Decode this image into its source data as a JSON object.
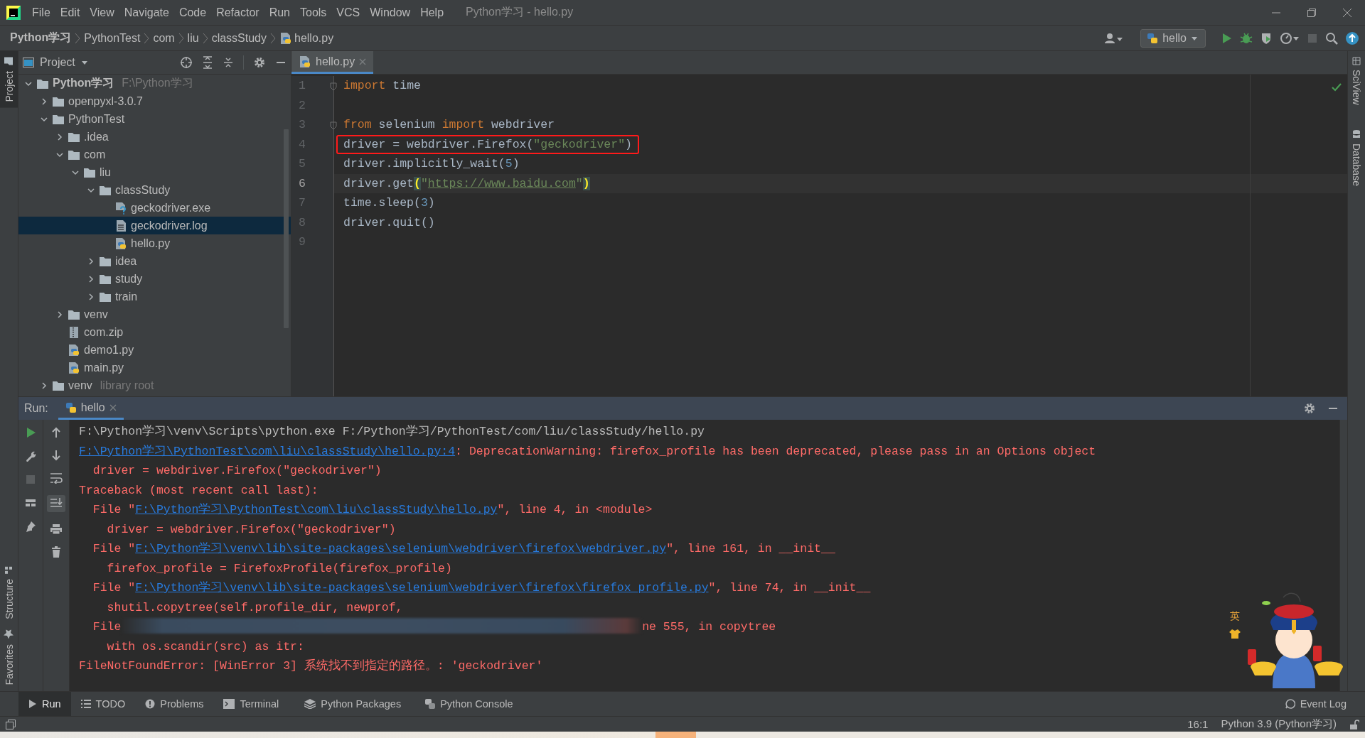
{
  "window": {
    "title": "Python学习 - hello.py",
    "menu": [
      "File",
      "Edit",
      "View",
      "Navigate",
      "Code",
      "Refactor",
      "Run",
      "Tools",
      "VCS",
      "Window",
      "Help"
    ]
  },
  "breadcrumbs": [
    {
      "label": "Python学习",
      "kind": "root"
    },
    {
      "label": "PythonTest",
      "kind": "folder"
    },
    {
      "label": "com",
      "kind": "folder"
    },
    {
      "label": "liu",
      "kind": "folder"
    },
    {
      "label": "classStudy",
      "kind": "folder"
    },
    {
      "label": "hello.py",
      "kind": "python"
    }
  ],
  "run_configuration": "hello",
  "side_stripes": {
    "left_top": [
      {
        "label": "Project",
        "selected": true
      }
    ],
    "left_bottom": [
      {
        "label": "Structure",
        "selected": false
      },
      {
        "label": "Favorites",
        "selected": false
      }
    ],
    "right": [
      {
        "label": "SciView",
        "selected": false
      },
      {
        "label": "Database",
        "selected": false
      }
    ]
  },
  "project_panel": {
    "title": "Project",
    "tree": [
      {
        "label": "Python学习",
        "kind": "project_root",
        "note": "F:\\Python学习",
        "expanded": true,
        "selected": false,
        "children": [
          {
            "label": "openpyxl-3.0.7",
            "kind": "folder",
            "expanded": false,
            "selected": false
          },
          {
            "label": "PythonTest",
            "kind": "folder",
            "expanded": true,
            "selected": false,
            "children": [
              {
                "label": ".idea",
                "kind": "folder",
                "expanded": false,
                "selected": false
              },
              {
                "label": "com",
                "kind": "folder",
                "expanded": true,
                "selected": false,
                "children": [
                  {
                    "label": "liu",
                    "kind": "folder",
                    "expanded": true,
                    "selected": false,
                    "children": [
                      {
                        "label": "classStudy",
                        "kind": "folder",
                        "expanded": true,
                        "selected": false,
                        "children": [
                          {
                            "label": "geckodriver.exe",
                            "kind": "unknown",
                            "selected": false
                          },
                          {
                            "label": "geckodriver.log",
                            "kind": "log",
                            "selected": true
                          },
                          {
                            "label": "hello.py",
                            "kind": "python",
                            "selected": false
                          }
                        ]
                      },
                      {
                        "label": "idea",
                        "kind": "folder",
                        "expanded": false,
                        "selected": false
                      },
                      {
                        "label": "study",
                        "kind": "folder",
                        "expanded": false,
                        "selected": false
                      },
                      {
                        "label": "train",
                        "kind": "folder",
                        "expanded": false,
                        "selected": false
                      }
                    ]
                  }
                ]
              },
              {
                "label": "venv",
                "kind": "folder",
                "expanded": false,
                "selected": false
              },
              {
                "label": "com.zip",
                "kind": "zip",
                "selected": false
              },
              {
                "label": "demo1.py",
                "kind": "python",
                "selected": false
              },
              {
                "label": "main.py",
                "kind": "python",
                "selected": false
              }
            ]
          },
          {
            "label": "venv",
            "kind": "folder",
            "note": "library root",
            "expanded": false,
            "selected": false
          }
        ]
      }
    ]
  },
  "editor": {
    "tab": {
      "label": "hello.py",
      "selected": true
    },
    "lines": [
      {
        "number": "1",
        "current": false,
        "boxed": false,
        "fold": true,
        "tokens": [
          {
            "text": "import",
            "kind": "keyword"
          },
          {
            "text": " time",
            "kind": "plain"
          }
        ]
      },
      {
        "number": "2"
      },
      {
        "number": "3",
        "current": false,
        "boxed": false,
        "fold": true,
        "tokens": [
          {
            "text": "from",
            "kind": "keyword"
          },
          {
            "text": " selenium ",
            "kind": "plain"
          },
          {
            "text": "import",
            "kind": "keyword"
          },
          {
            "text": " webdriver",
            "kind": "plain"
          }
        ]
      },
      {
        "number": "4",
        "current": false,
        "boxed": true,
        "fold": false,
        "tokens": [
          {
            "text": "driver = webdriver.Firefox(",
            "kind": "plain"
          },
          {
            "text": "\"geckodriver\"",
            "kind": "string"
          },
          {
            "text": ")",
            "kind": "plain"
          }
        ]
      },
      {
        "number": "5",
        "current": false,
        "boxed": false,
        "fold": false,
        "tokens": [
          {
            "text": "driver.implicitly_wait(",
            "kind": "plain"
          },
          {
            "text": "5",
            "kind": "number"
          },
          {
            "text": ")",
            "kind": "plain"
          }
        ]
      },
      {
        "number": "6",
        "current": true,
        "boxed": false,
        "fold": false,
        "tokens": [
          {
            "text": "driver.get",
            "kind": "plain"
          },
          {
            "text": "(",
            "kind": "brace"
          },
          {
            "text": "\"",
            "kind": "string"
          },
          {
            "text": "https://www.baidu.com",
            "kind": "url"
          },
          {
            "text": "\"",
            "kind": "string"
          },
          {
            "text": ")",
            "kind": "brace"
          }
        ]
      },
      {
        "number": "7",
        "current": false,
        "boxed": false,
        "fold": false,
        "tokens": [
          {
            "text": "time.sleep(",
            "kind": "plain"
          },
          {
            "text": "3",
            "kind": "number"
          },
          {
            "text": ")",
            "kind": "plain"
          }
        ]
      },
      {
        "number": "8",
        "current": false,
        "boxed": false,
        "fold": false,
        "tokens": [
          {
            "text": "driver.quit()",
            "kind": "plain"
          }
        ]
      },
      {
        "number": "9"
      }
    ]
  },
  "run_panel": {
    "label": "Run:",
    "tab": {
      "label": "hello",
      "selected": true
    },
    "output": [
      {
        "segments": [
          {
            "text": "F:\\Python学习\\venv\\Scripts\\python.exe F:/Python学习/PythonTest/com/liu/classStudy/hello.py",
            "kind": "plain"
          }
        ]
      },
      {
        "segments": [
          {
            "text": "F:\\Python学习\\PythonTest\\com\\liu\\classStudy\\hello.py:4",
            "kind": "link"
          },
          {
            "text": ": DeprecationWarning: firefox_profile has been deprecated, please pass in an Options object",
            "kind": "error"
          }
        ]
      },
      {
        "segments": [
          {
            "text": "  driver = webdriver.Firefox(\"geckodriver\")",
            "kind": "error"
          }
        ]
      },
      {
        "segments": [
          {
            "text": "Traceback (most recent call last):",
            "kind": "error"
          }
        ]
      },
      {
        "segments": [
          {
            "text": "  File \"",
            "kind": "error"
          },
          {
            "text": "F:\\Python学习\\PythonTest\\com\\liu\\classStudy\\hello.py",
            "kind": "link"
          },
          {
            "text": "\", line 4, in <module>",
            "kind": "error"
          }
        ]
      },
      {
        "segments": [
          {
            "text": "    driver = webdriver.Firefox(\"geckodriver\")",
            "kind": "error"
          }
        ]
      },
      {
        "segments": [
          {
            "text": "  File \"",
            "kind": "error"
          },
          {
            "text": "F:\\Python学习\\venv\\lib\\site-packages\\selenium\\webdriver\\firefox\\webdriver.py",
            "kind": "link"
          },
          {
            "text": "\", line 161, in __init__",
            "kind": "error"
          }
        ]
      },
      {
        "segments": [
          {
            "text": "    firefox_profile = FirefoxProfile(firefox_profile)",
            "kind": "error"
          }
        ]
      },
      {
        "segments": [
          {
            "text": "  File \"",
            "kind": "error"
          },
          {
            "text": "F:\\Python学习\\venv\\lib\\site-packages\\selenium\\webdriver\\firefox\\firefox_profile.py",
            "kind": "link"
          },
          {
            "text": "\", line 74, in __init__",
            "kind": "error"
          }
        ]
      },
      {
        "segments": [
          {
            "text": "    shutil.copytree(self.profile_dir, newprof,",
            "kind": "error"
          }
        ]
      },
      {
        "segments": [
          {
            "text": "  File",
            "kind": "error"
          },
          {
            "kind": "redacted"
          },
          {
            "text": "ne 555, in copytree",
            "kind": "error"
          }
        ]
      },
      {
        "segments": [
          {
            "text": "    with os.scandir(src) as itr:",
            "kind": "error"
          }
        ]
      },
      {
        "segments": [
          {
            "text": "FileNotFoundError: [WinError 3] 系统找不到指定的路径。: 'geckodriver'",
            "kind": "error"
          }
        ]
      }
    ]
  },
  "overlay": {
    "ime_indicator": "英"
  },
  "bottom_tabs": [
    {
      "label": "Run",
      "kind": "run",
      "selected": true
    },
    {
      "label": "TODO",
      "kind": "todo",
      "selected": false
    },
    {
      "label": "Problems",
      "kind": "problems",
      "selected": false
    },
    {
      "label": "Terminal",
      "kind": "terminal",
      "selected": false
    },
    {
      "label": "Python Packages",
      "kind": "packages",
      "selected": false
    },
    {
      "label": "Python Console",
      "kind": "console",
      "selected": false
    }
  ],
  "event_log": "Event Log",
  "status_bar": {
    "position": "16:1",
    "interpreter": "Python 3.9 (Python学习)"
  }
}
